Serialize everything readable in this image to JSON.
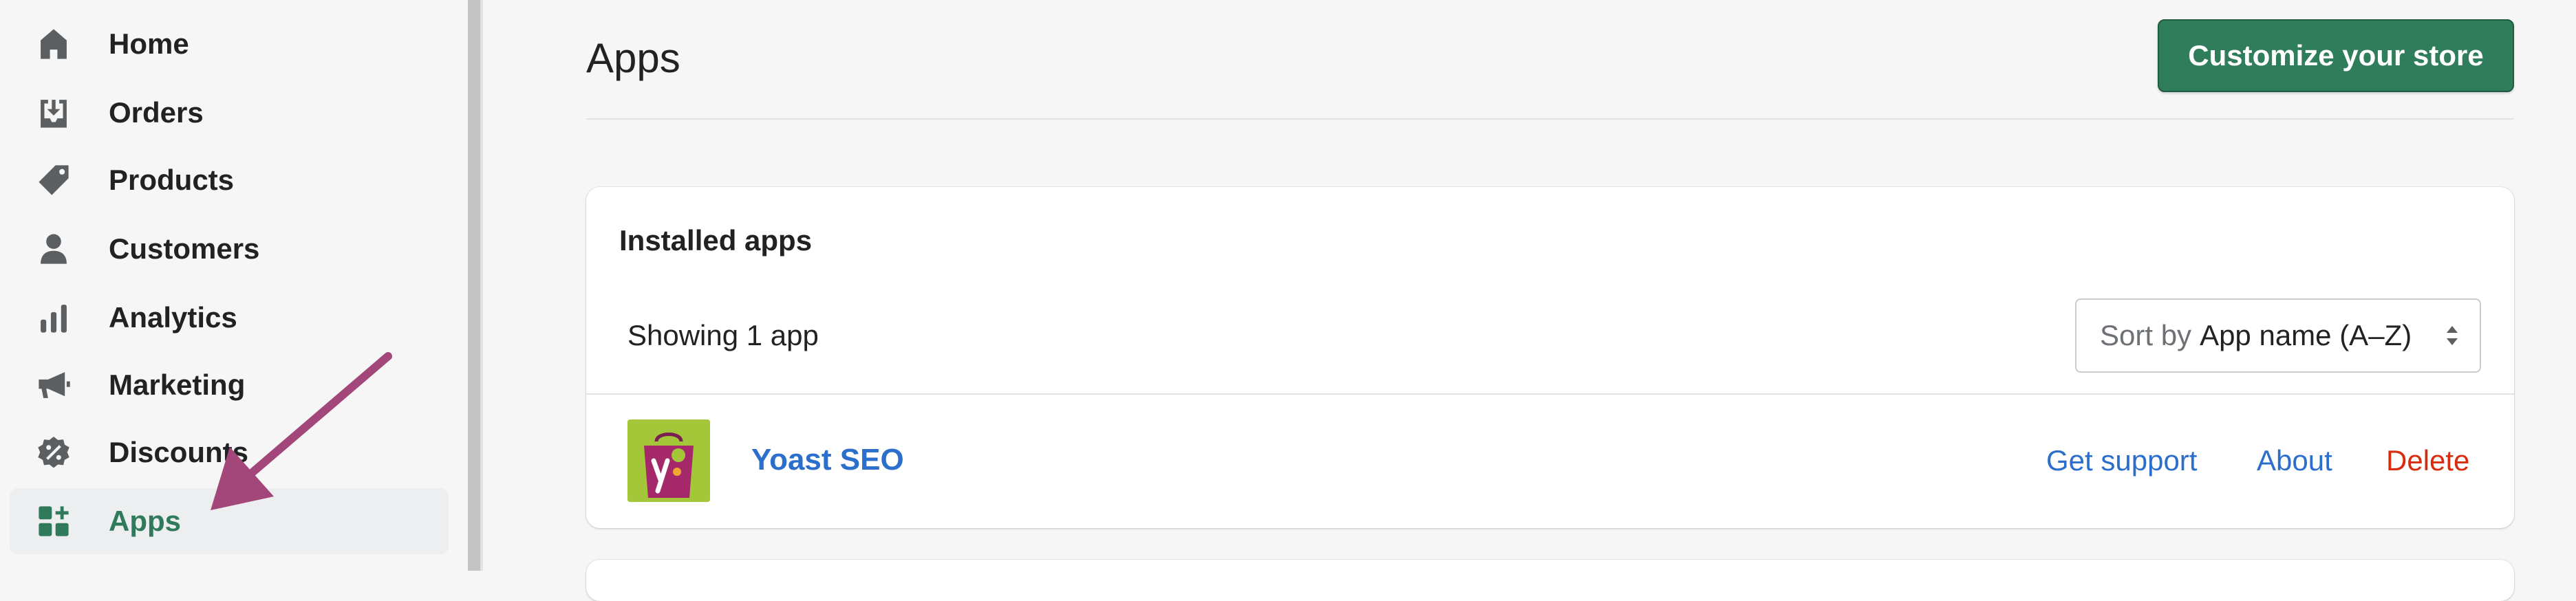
{
  "sidebar": {
    "items": [
      {
        "label": "Home",
        "icon": "home-icon"
      },
      {
        "label": "Orders",
        "icon": "orders-icon"
      },
      {
        "label": "Products",
        "icon": "tag-icon"
      },
      {
        "label": "Customers",
        "icon": "person-icon"
      },
      {
        "label": "Analytics",
        "icon": "bar-chart-icon"
      },
      {
        "label": "Marketing",
        "icon": "megaphone-icon"
      },
      {
        "label": "Discounts",
        "icon": "discount-icon"
      },
      {
        "label": "Apps",
        "icon": "apps-icon",
        "active": true
      }
    ]
  },
  "header": {
    "title": "Apps",
    "customize_label": "Customize your store"
  },
  "installed_apps": {
    "title": "Installed apps",
    "count_text": "Showing 1 app",
    "sort": {
      "prefix": "Sort by",
      "selected": "App name (A–Z)"
    },
    "apps": [
      {
        "name": "Yoast SEO",
        "logo_icon": "yoast-bag-icon",
        "actions": {
          "support": "Get support",
          "about": "About",
          "delete": "Delete"
        }
      }
    ]
  },
  "annotation": {
    "arrow_color": "#a3477a",
    "target": "Apps"
  },
  "colors": {
    "accent_green": "#2f7d5b",
    "link_blue": "#2c6ecb",
    "delete_red": "#d72c0d",
    "yoast_green": "#a4c639",
    "yoast_purple": "#a4286a"
  }
}
